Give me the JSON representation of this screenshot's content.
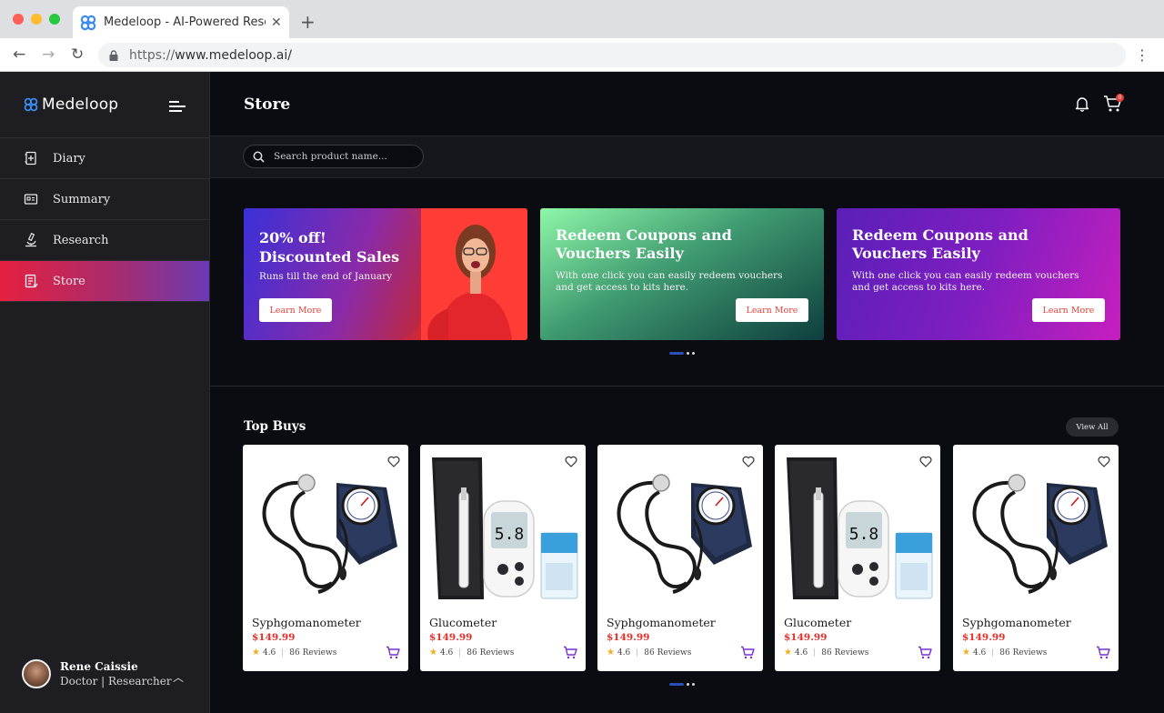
{
  "browser": {
    "tab_title": "Medeloop - AI-Powered Research",
    "url_scheme": "https://",
    "url_host": "www.medeloop.ai/",
    "new_tab": "+",
    "close": "✕"
  },
  "sidebar": {
    "brand": "Medeloop",
    "items": [
      {
        "label": "Diary",
        "icon": "diary-icon"
      },
      {
        "label": "Summary",
        "icon": "summary-icon"
      },
      {
        "label": "Research",
        "icon": "microscope-icon"
      },
      {
        "label": "Store",
        "icon": "store-icon",
        "active": true
      }
    ],
    "user": {
      "name": "Rene Caissie",
      "role": "Doctor | Researcher"
    }
  },
  "header": {
    "title": "Store",
    "cart_count": "0"
  },
  "search": {
    "placeholder": "Search product name..."
  },
  "banners": [
    {
      "title_line1": "20% off!",
      "title_line2": "Discounted Sales",
      "subtitle": "Runs till the end of January",
      "button": "Learn More"
    },
    {
      "title_line1": "Redeem Coupons and",
      "title_line2": "Vouchers Easily",
      "subtitle": "With one click you can easily redeem vouchers and get access to kits here.",
      "button": "Learn More"
    },
    {
      "title_line1": "Redeem Coupons and",
      "title_line2": "Vouchers Easily",
      "subtitle": "With one click you can easily redeem vouchers and get access to kits here.",
      "button": "Learn More"
    }
  ],
  "top_buys": {
    "title": "Top Buys",
    "view_all": "View All",
    "products": [
      {
        "name": "Syphgomanometer",
        "price": "$149.99",
        "rating": "4.6",
        "reviews": "86 Reviews",
        "image": "sphygmomanometer"
      },
      {
        "name": "Glucometer",
        "price": "$149.99",
        "rating": "4.6",
        "reviews": "86 Reviews",
        "image": "glucometer"
      },
      {
        "name": "Syphgomanometer",
        "price": "$149.99",
        "rating": "4.6",
        "reviews": "86 Reviews",
        "image": "sphygmomanometer"
      },
      {
        "name": "Glucometer",
        "price": "$149.99",
        "rating": "4.6",
        "reviews": "86 Reviews",
        "image": "glucometer"
      },
      {
        "name": "Syphgomanometer",
        "price": "$149.99",
        "rating": "4.6",
        "reviews": "86 Reviews",
        "image": "sphygmomanometer"
      }
    ]
  },
  "colors": {
    "accent_red": "#e5302a",
    "cart_purple": "#7b2fd0",
    "star": "#f2b01e"
  }
}
